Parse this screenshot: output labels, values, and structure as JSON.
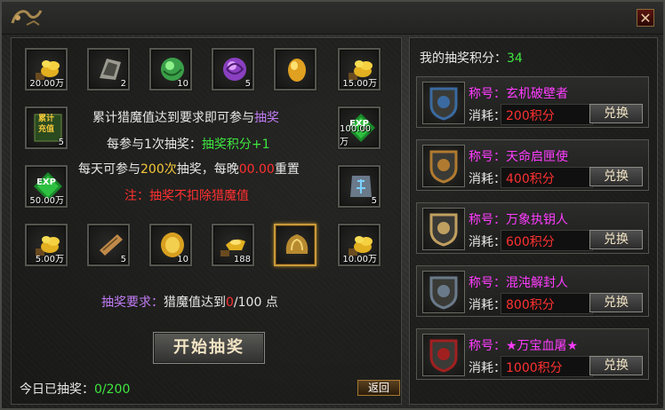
{
  "close_glyph": "✕",
  "grid": [
    {
      "icon": "gold-coins-icon",
      "qty": "20.00万"
    },
    {
      "icon": "talisman-scroll-icon",
      "qty": "2"
    },
    {
      "icon": "green-orb-icon",
      "qty": "10"
    },
    {
      "icon": "purple-orb-icon",
      "qty": "5"
    },
    {
      "icon": "golden-egg-icon",
      "qty": ""
    },
    {
      "icon": "gold-coins-icon",
      "qty": "15.00万"
    },
    {
      "icon": "recharge-voucher-icon",
      "qty": "5",
      "icon_text": "累计\n充值"
    },
    {
      "icon": "exp-gem-icon",
      "qty": "100.00万",
      "icon_text": "EXP"
    },
    {
      "icon": "exp-gem-icon",
      "qty": "50.00万",
      "icon_text": "EXP"
    },
    {
      "icon": "blue-rune-icon",
      "qty": "5"
    },
    {
      "icon": "gold-coins-icon",
      "qty": "5.00万"
    },
    {
      "icon": "scroll-icon",
      "qty": "5"
    },
    {
      "icon": "gold-medal-icon",
      "qty": "10"
    },
    {
      "icon": "gold-ingot-icon",
      "qty": "188"
    },
    {
      "icon": "ornament-icon",
      "qty": ""
    },
    {
      "icon": "gold-coins-icon",
      "qty": "10.00万"
    }
  ],
  "info": {
    "line1_a": "累计猎魔值达到要求即可参与",
    "line1_b": "抽奖",
    "line2_a": "每参与1次抽奖：",
    "line2_b": "抽奖积分+1",
    "line3_a": "每天可参与",
    "line3_b": "200次",
    "line3_c": "抽奖，每晚",
    "line3_d": "00.00",
    "line3_e": "重置",
    "line4": "注：抽奖不扣除猎魔值"
  },
  "requirement": {
    "label": "抽奖要求：",
    "text_a": "猎魔值达到",
    "current": "0",
    "text_b": "/100 点"
  },
  "start_button": "开始抽奖",
  "today": {
    "label": "今日已抽奖：",
    "value": "0/200"
  },
  "back_button": "返回",
  "points": {
    "label": "我的抽奖积分：",
    "value": "34"
  },
  "exchange": [
    {
      "title_label": "称号：",
      "title": "玄机破壁者",
      "cost_label": "消耗：",
      "cost": "200积分",
      "button": "兑换",
      "color": "#3a6aa0"
    },
    {
      "title_label": "称号：",
      "title": "天命启匣使",
      "cost_label": "消耗：",
      "cost": "400积分",
      "button": "兑换",
      "color": "#b07a30"
    },
    {
      "title_label": "称号：",
      "title": "万象执钥人",
      "cost_label": "消耗：",
      "cost": "600积分",
      "button": "兑换",
      "color": "#c0a060"
    },
    {
      "title_label": "称号：",
      "title": "混沌解封人",
      "cost_label": "消耗：",
      "cost": "800积分",
      "button": "兑换",
      "color": "#6a7a8a"
    },
    {
      "title_label": "称号：",
      "title": "★万宝血屠★",
      "cost_label": "消耗：",
      "cost": "1000积分",
      "button": "兑换",
      "color": "#a02020"
    }
  ]
}
